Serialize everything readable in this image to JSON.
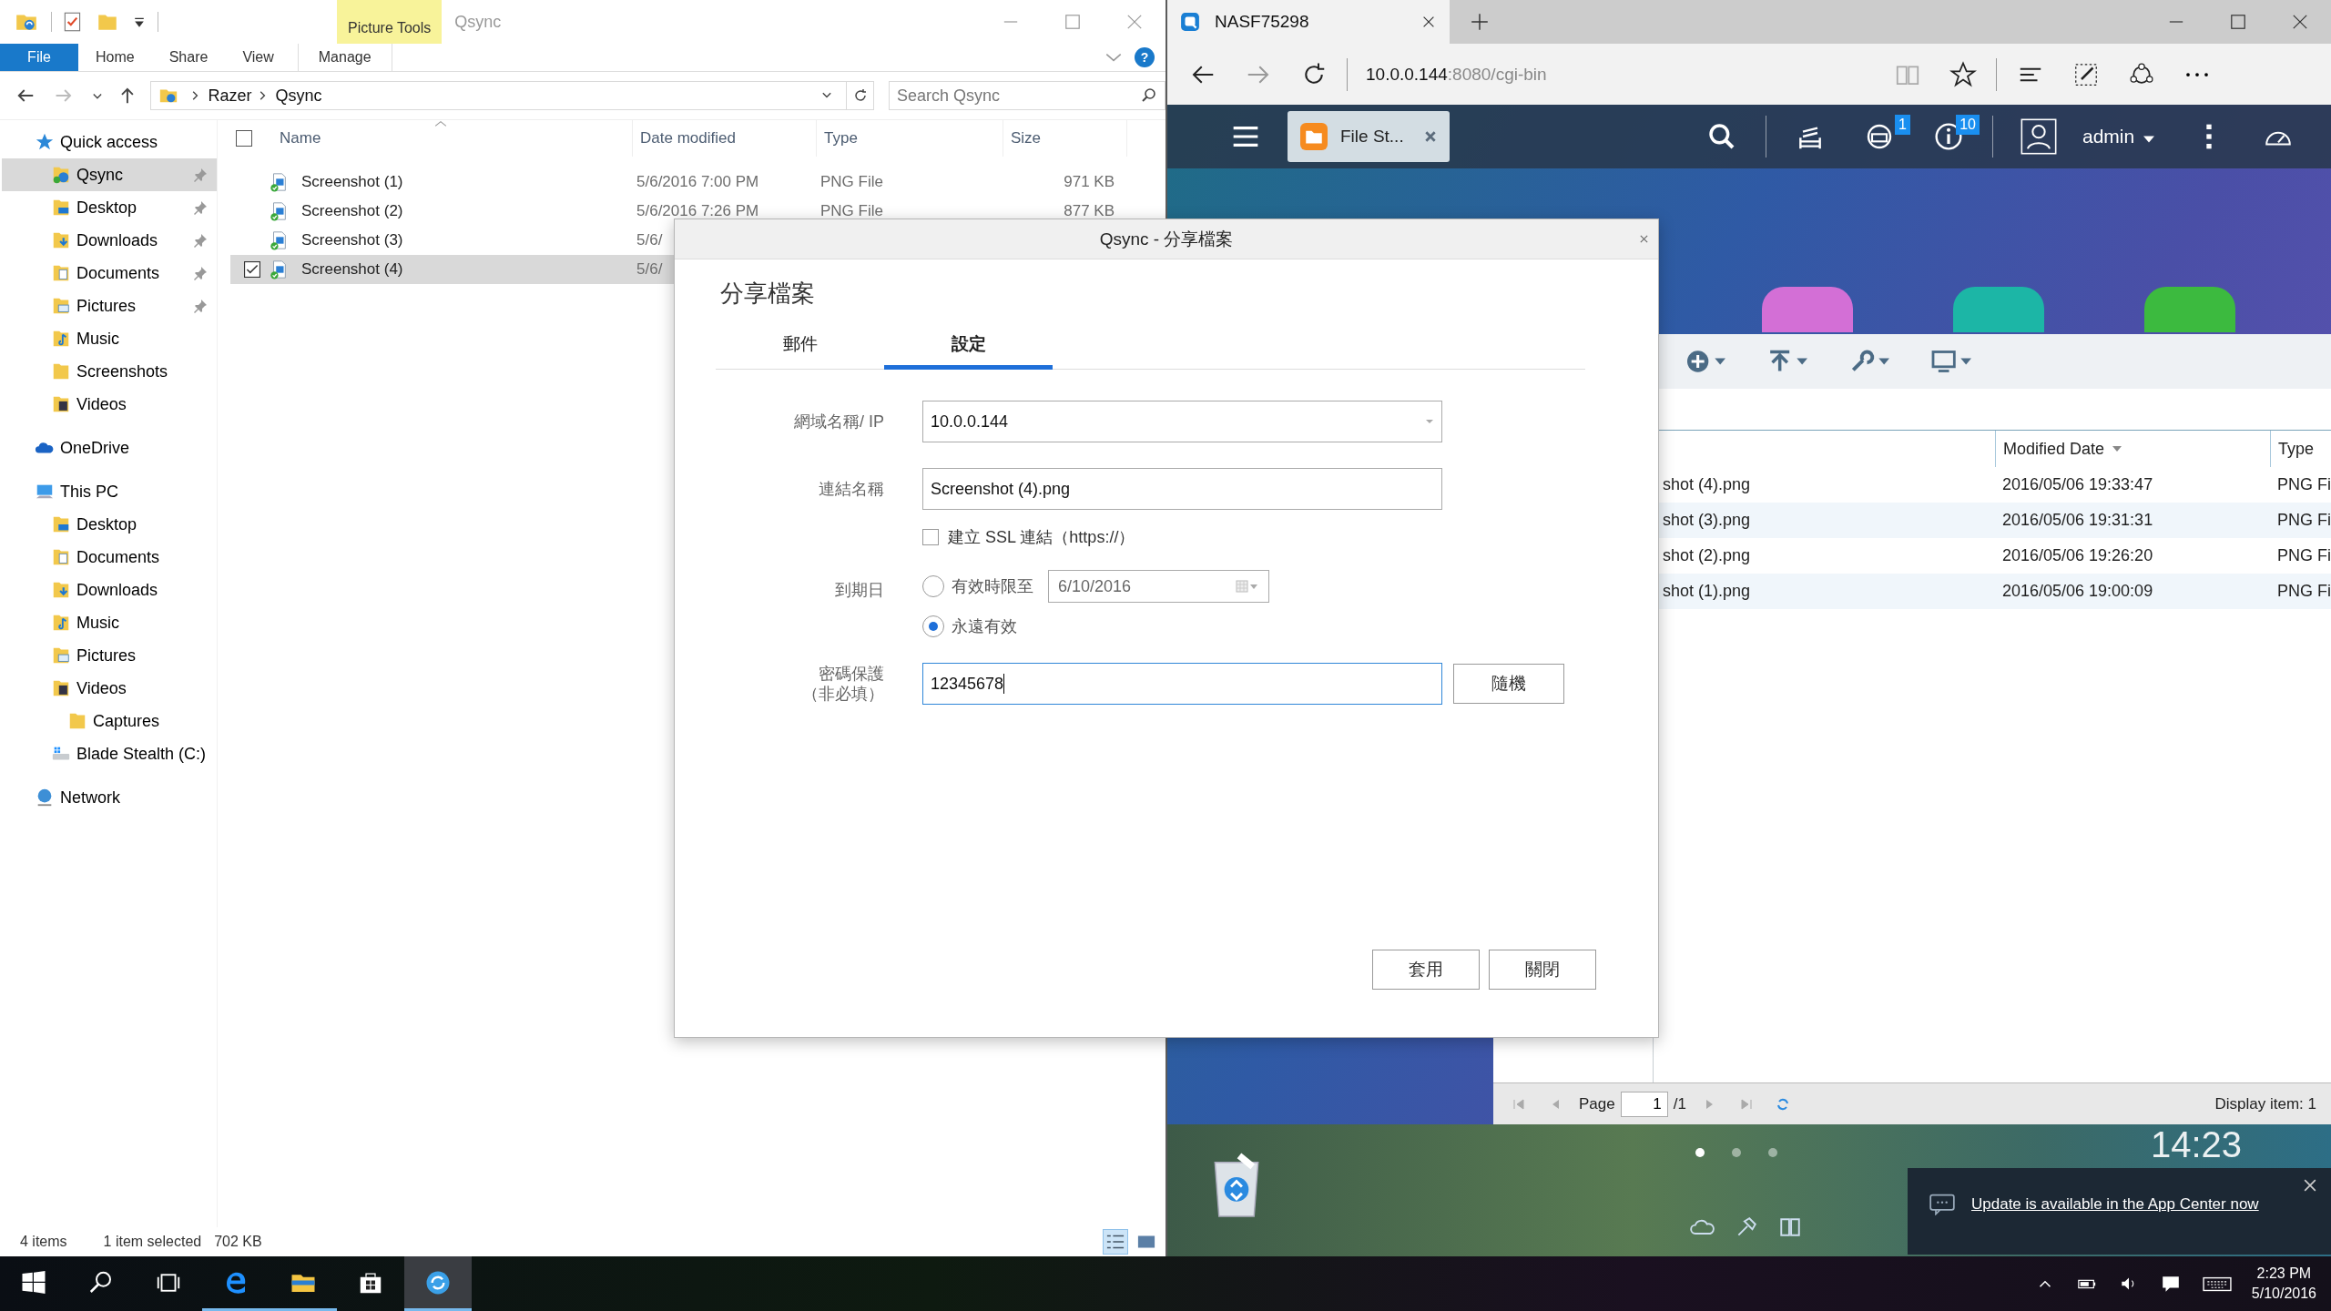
{
  "explorer": {
    "title": "Qsync",
    "context_tab_group": "Picture Tools",
    "file_tab": "File",
    "ribbon_tabs": [
      {
        "label": "Home",
        "kind": "plain",
        "selected": false
      },
      {
        "label": "Share",
        "kind": "plain",
        "selected": false
      },
      {
        "label": "View",
        "kind": "plain",
        "selected": false
      },
      {
        "label": "Manage",
        "kind": "context",
        "selected": false
      }
    ],
    "help": "?",
    "select_all_checked": false,
    "breadcrumb": [
      "Razer",
      "Qsync"
    ],
    "search": {
      "placeholder": "Search Qsync"
    },
    "nav": [
      {
        "label": "Quick access",
        "kind": "star",
        "selected": false,
        "pinned": false,
        "children": [
          {
            "label": "Qsync",
            "kind": "qsync",
            "selected": true,
            "pinned": true
          },
          {
            "label": "Desktop",
            "kind": "desktop",
            "selected": false,
            "pinned": true
          },
          {
            "label": "Downloads",
            "kind": "downloads",
            "selected": false,
            "pinned": true
          },
          {
            "label": "Documents",
            "kind": "documents",
            "selected": false,
            "pinned": true
          },
          {
            "label": "Pictures",
            "kind": "pictures",
            "selected": false,
            "pinned": true
          },
          {
            "label": "Music",
            "kind": "music",
            "selected": false,
            "pinned": false
          },
          {
            "label": "Screenshots",
            "kind": "folder",
            "selected": false,
            "pinned": false
          },
          {
            "label": "Videos",
            "kind": "videos",
            "selected": false,
            "pinned": false
          }
        ]
      },
      {
        "label": "OneDrive",
        "kind": "cloud",
        "selected": false,
        "pinned": false
      },
      {
        "label": "This PC",
        "kind": "pc",
        "selected": false,
        "pinned": false,
        "children": [
          {
            "label": "Desktop",
            "kind": "desktop",
            "selected": false,
            "pinned": false
          },
          {
            "label": "Documents",
            "kind": "documents",
            "selected": false,
            "pinned": false
          },
          {
            "label": "Downloads",
            "kind": "downloads",
            "selected": false,
            "pinned": false
          },
          {
            "label": "Music",
            "kind": "music",
            "selected": false,
            "pinned": false
          },
          {
            "label": "Pictures",
            "kind": "pictures",
            "selected": false,
            "pinned": false
          },
          {
            "label": "Videos",
            "kind": "videos",
            "selected": false,
            "pinned": false,
            "children": [
              {
                "label": "Captures",
                "kind": "folder",
                "selected": false,
                "pinned": false
              }
            ]
          },
          {
            "label": "Blade Stealth (C:)",
            "kind": "drive",
            "selected": false,
            "pinned": false
          }
        ]
      },
      {
        "label": "Network",
        "kind": "network",
        "selected": false,
        "pinned": false
      }
    ],
    "columns": [
      {
        "label": "Name",
        "sorted": true
      },
      {
        "label": "Date modified",
        "sorted": false
      },
      {
        "label": "Type",
        "sorted": false
      },
      {
        "label": "Size",
        "sorted": false
      }
    ],
    "rows": [
      {
        "name": "Screenshot (1)",
        "date": "5/6/2016 7:00 PM",
        "type": "PNG File",
        "size": "971 KB",
        "selected": false
      },
      {
        "name": "Screenshot (2)",
        "date": "5/6/2016 7:26 PM",
        "type": "PNG File",
        "size": "877 KB",
        "selected": false
      },
      {
        "name": "Screenshot (3)",
        "date": "5/6/",
        "selected": false
      },
      {
        "name": "Screenshot (4)",
        "date": "5/6/",
        "selected": true
      }
    ],
    "status": {
      "count": "4 items",
      "selection": "1 item selected",
      "size": "702 KB"
    }
  },
  "browser": {
    "tab_title": "NASF75298",
    "url_host": "10.0.0.144",
    "url_path": ":8080/cgi-bin",
    "qts": {
      "app_tab": "File St...",
      "sync_badge": "1",
      "info_badge": "10",
      "user": "admin",
      "file_station": {
        "columns": [
          {
            "label": "Modified Date",
            "sorted": true
          },
          {
            "label": "Type",
            "sorted": false
          }
        ],
        "rows": [
          {
            "name": "shot (4).png",
            "date": "2016/05/06 19:33:47",
            "type": "PNG Fi"
          },
          {
            "name": "shot (3).png",
            "date": "2016/05/06 19:31:31",
            "type": "PNG Fi"
          },
          {
            "name": "shot (2).png",
            "date": "2016/05/06 19:26:20",
            "type": "PNG Fi"
          },
          {
            "name": "shot (1).png",
            "date": "2016/05/06 19:00:09",
            "type": "PNG Fi"
          }
        ],
        "pager": {
          "label": "Page",
          "page": "1",
          "total": "/1",
          "display": "Display item: 1"
        }
      },
      "clock": "14:23",
      "page_dots": [
        {
          "selected": true
        },
        {
          "selected": false
        },
        {
          "selected": false
        }
      ],
      "notification": {
        "text": "Update is available in the App Center now"
      }
    }
  },
  "dialog": {
    "title": "Qsync - 分享檔案",
    "heading": "分享檔案",
    "tabs": [
      {
        "label": "郵件",
        "selected": false
      },
      {
        "label": "設定",
        "selected": true
      }
    ],
    "host": {
      "label": "網域名稱/ IP",
      "value": "10.0.0.144"
    },
    "link_name": {
      "label": "連結名稱",
      "value": "Screenshot (4).png"
    },
    "ssl": {
      "label": "建立 SSL 連結（https://）",
      "checked": false
    },
    "expiry": {
      "label": "到期日",
      "options": [
        {
          "label": "有效時限至",
          "selected": false,
          "date": "6/10/2016"
        },
        {
          "label": "永遠有效",
          "selected": true
        }
      ]
    },
    "password": {
      "label": "密碼保護",
      "note": "（非必填）",
      "value": "12345678",
      "focused": true
    },
    "random_button": "隨機",
    "buttons": [
      "套用",
      "關閉"
    ]
  },
  "taskbar": {
    "apps": [
      {
        "kind": "edge",
        "running": true,
        "selected": false
      },
      {
        "kind": "explorer",
        "running": true,
        "selected": false
      },
      {
        "kind": "store",
        "running": false,
        "selected": false
      },
      {
        "kind": "qsync",
        "running": true,
        "selected": true
      }
    ],
    "time": "2:23 PM",
    "date": "5/10/2016"
  }
}
